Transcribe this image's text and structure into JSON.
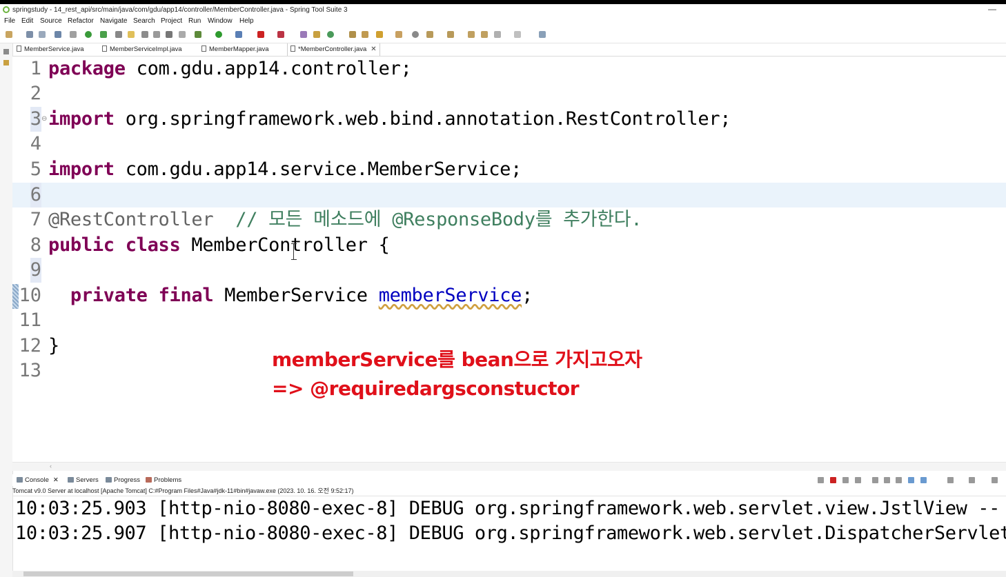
{
  "window": {
    "title": "springstudy - 14_rest_api/src/main/java/com/gdu/app14/controller/MemberController.java - Spring Tool Suite 3",
    "minimize_glyph": "—"
  },
  "menu": [
    "File",
    "Edit",
    "Source",
    "Refactor",
    "Navigate",
    "Search",
    "Project",
    "Run",
    "Window",
    "Help"
  ],
  "tabs": [
    {
      "label": "MemberService.java",
      "active": false
    },
    {
      "label": "MemberServiceImpl.java",
      "active": false
    },
    {
      "label": "MemberMapper.java",
      "active": false
    },
    {
      "label": "*MemberController.java",
      "active": true
    }
  ],
  "editor": {
    "line_numbers": [
      "1",
      "2",
      "3",
      "4",
      "5",
      "6",
      "7",
      "8",
      "9",
      "10",
      "11",
      "12",
      "13"
    ],
    "current_line": "6",
    "code": {
      "l1_kw": "package",
      "l1_rest": " com.gdu.app14.controller;",
      "l3_kw": "import",
      "l3_rest": " org.springframework.web.bind.annotation.RestController;",
      "l5_kw": "import",
      "l5_rest": " com.gdu.app14.service.MemberService;",
      "l7_ann": "@RestController",
      "l7_cmt": "  // 모든 메소드에 @ResponseBody를 추가한다.",
      "l8_kw": "public class",
      "l8_rest": " MemberController {",
      "l10_indent": "  ",
      "l10_kw": "private final",
      "l10_type": " MemberService ",
      "l10_field": "memberService",
      "l10_end": ";",
      "l12": "}"
    }
  },
  "overlay_note": {
    "line1": "memberService를 bean으로 가지고오자",
    "line2": "=> @requiredargsconstuctor",
    "color": "#e0101a"
  },
  "console": {
    "tabs": [
      "Console",
      "Servers",
      "Progress",
      "Problems"
    ],
    "description": "Tomcat v9.0 Server at localhost [Apache Tomcat] C:#Program Files#Java#jdk-11#bin#javaw.exe  (2023. 10. 16. 오전 9:52:17)",
    "lines": [
      "10:03:25.903 [http-nio-8080-exec-8] DEBUG org.springframework.web.servlet.view.JstlView --",
      "10:03:25.907 [http-nio-8080-exec-8] DEBUG org.springframework.web.servlet.DispatcherServlet"
    ]
  },
  "colors": {
    "keyword": "#7f0055",
    "comment": "#3f7f5f",
    "annotation": "#646464",
    "field": "#0000c0",
    "current_line_bg": "#eaf3fb"
  }
}
